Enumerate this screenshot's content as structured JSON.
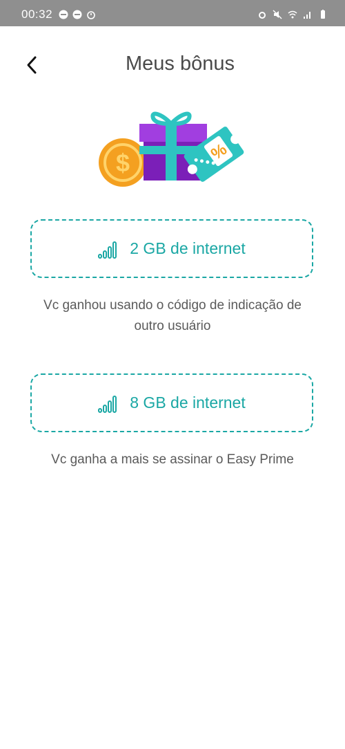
{
  "status_bar": {
    "time": "00:32",
    "left_icons": [
      "do-not-disturb-icon",
      "vivo-badge-icon",
      "timer-icon"
    ],
    "right_icons": [
      "alarm-icon",
      "mute-icon",
      "wifi-icon",
      "signal-icon",
      "battery-icon"
    ]
  },
  "header": {
    "back_icon": "chevron-left-icon",
    "title": "Meus bônus"
  },
  "bonuses": [
    {
      "icon": "signal-bars-icon",
      "label": "2 GB de internet",
      "description": "Vc ganhou usando o código de indicação de outro usuário"
    },
    {
      "icon": "signal-bars-icon",
      "label": "8 GB de internet",
      "description": "Vc ganha a mais se assinar o Easy Prime"
    }
  ],
  "colors": {
    "accent": "#1aa7a4",
    "status_bar": "#8f8f8f",
    "gift_purple": "#8e2bc9",
    "coin_orange": "#f4a020",
    "ticket_teal": "#2ec4c1"
  }
}
